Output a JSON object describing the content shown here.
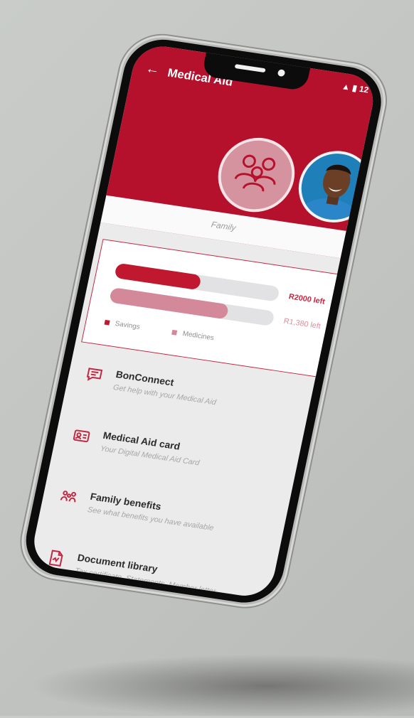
{
  "colors": {
    "brand": "#b5112d",
    "savings": "#c0192f",
    "medicines": "#d4899a",
    "track": "#e2e2e4"
  },
  "header": {
    "title": "Medical Aid",
    "back_icon": "arrow-left-icon",
    "status_text": "12"
  },
  "profiles": {
    "selected_label": "Family",
    "family_icon": "family-group-icon",
    "avatar_icon": "user-avatar-photo"
  },
  "balances": [
    {
      "name": "Savings",
      "remaining": "R2000 left",
      "fraction_used": 0.52
    },
    {
      "name": "Medicines",
      "remaining": "R1,380 left",
      "fraction_used": 0.72
    }
  ],
  "legend": {
    "savings": "Savings",
    "medicines": "Medicines"
  },
  "menu": [
    {
      "title": "BonConnect",
      "subtitle": "Get help with your Medical Aid",
      "icon": "chat-icon"
    },
    {
      "title": "Medical Aid card",
      "subtitle": "Your Digital Medical Aid Card",
      "icon": "id-card-icon"
    },
    {
      "title": "Family benefits",
      "subtitle": "See what benefits you have available",
      "icon": "family-benefits-icon"
    },
    {
      "title": "Document library",
      "subtitle": "Tax certificate, Statements, Member letter",
      "icon": "document-icon"
    }
  ]
}
